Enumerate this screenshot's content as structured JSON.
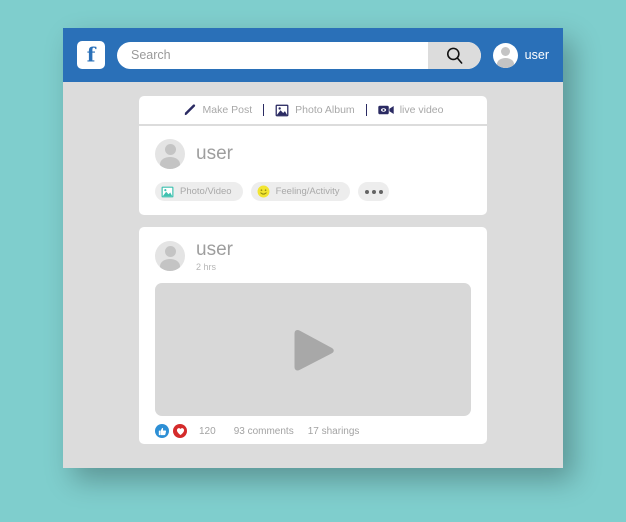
{
  "theme": {
    "background": "#7fcecd",
    "window_bg": "#dcdcdc",
    "topbar_blue": "#2a70b8",
    "card_white": "#ffffff",
    "icon_navy": "#2b2b63",
    "chip_grey": "#ededed",
    "like_blue": "#2d8fd5",
    "love_red": "#d42b2b",
    "photo_teal": "#3fc1b0",
    "smiley_yellow": "#f2e531"
  },
  "topbar": {
    "logo_icon": "facebook-f-icon",
    "logo_letter": "f",
    "search": {
      "placeholder": "Search",
      "value": "",
      "button_icon": "search-icon"
    },
    "account": {
      "avatar_icon": "user-avatar-icon",
      "name": "user"
    }
  },
  "toolbar": {
    "items": [
      {
        "label": "Make Post",
        "icon": "pencil-icon"
      },
      {
        "label": "Photo Album",
        "icon": "photo-icon"
      },
      {
        "label": "live video",
        "icon": "video-camera-icon"
      }
    ]
  },
  "composer": {
    "avatar_icon": "user-avatar-icon",
    "name": "user",
    "chips": [
      {
        "label": "Photo/Video",
        "icon": "photo-icon"
      },
      {
        "label": "Feeling/Activity",
        "icon": "smiley-icon"
      }
    ],
    "more_icon": "ellipsis-icon"
  },
  "post": {
    "avatar_icon": "user-avatar-icon",
    "name": "user",
    "time": "2 hrs",
    "media": {
      "type": "video",
      "play_icon": "play-icon"
    },
    "engagement": {
      "reactions": [
        {
          "name": "like",
          "icon": "thumbs-up-icon",
          "color": "#2d8fd5"
        },
        {
          "name": "love",
          "icon": "heart-icon",
          "color": "#d42b2b"
        }
      ],
      "reaction_count": "120",
      "comments": "93 comments",
      "shares": "17 sharings"
    }
  }
}
